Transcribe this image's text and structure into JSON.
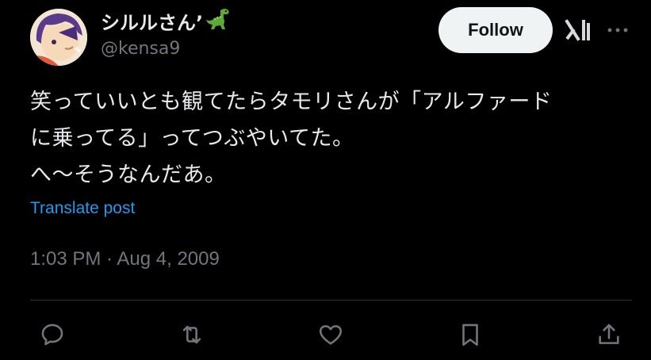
{
  "author": {
    "display_name": "シルルさん’",
    "handle": "@kensa9",
    "avatar_icon": "user-avatar",
    "name_emoji_icon": "dinosaur-icon"
  },
  "header": {
    "follow_label": "Follow",
    "grok_icon": "grok-icon",
    "more_icon": "more-options-icon"
  },
  "post": {
    "text": "笑っていいとも観てたらタモリさんが「アルファード\nに乗ってる」ってつぶやいてた。\nへ～そうなんだあ。",
    "translate_label": "Translate post",
    "timestamp": "1:03 PM · Aug 4, 2009"
  },
  "actions": [
    "reply-icon",
    "repost-icon",
    "like-icon",
    "bookmark-icon",
    "share-icon"
  ],
  "colors": {
    "background": "#000000",
    "text": "#e7e9ea",
    "secondary": "#71767b",
    "link": "#1d9bf0",
    "button_bg": "#eff3f4",
    "divider": "#2f3336"
  }
}
